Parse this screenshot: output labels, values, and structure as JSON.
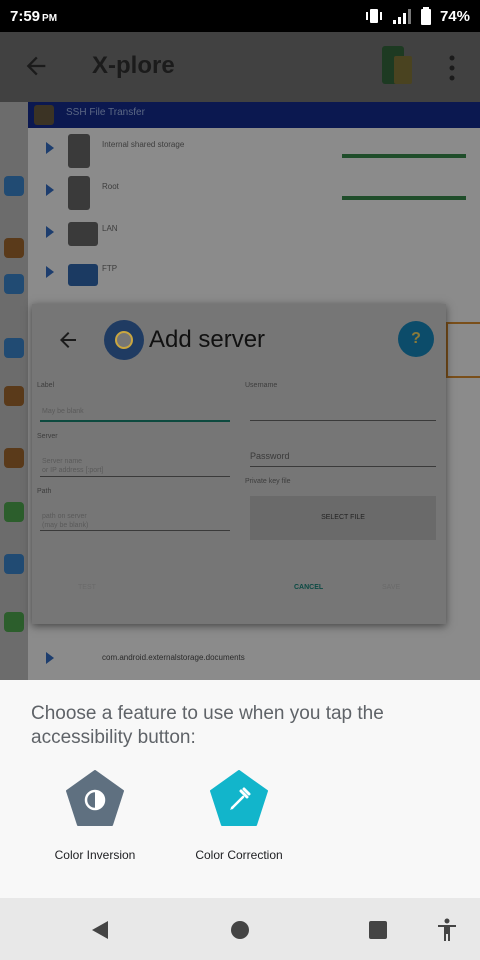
{
  "status": {
    "time": "7:59",
    "ampm": "PM",
    "battery": "74%",
    "icons": [
      "vibrate-icon",
      "signal-icon",
      "battery-icon"
    ]
  },
  "app": {
    "title": "X-plore",
    "ssh_header": "SSH File Transfer",
    "rows": [
      {
        "name": "Internal shared storage"
      },
      {
        "name": "Root"
      },
      {
        "name": "LAN"
      },
      {
        "name": "FTP"
      }
    ],
    "path_row": "com.android.externalstorage.documents"
  },
  "dialog": {
    "title": "Add server",
    "help": "?",
    "label_label": "Label",
    "label_hint": "May be blank",
    "server_label": "Server",
    "server_hint": "Server name\nor IP address [:port]",
    "path_label": "Path",
    "path_hint": "path on server\n(may be blank)",
    "username_label": "Username",
    "password_placeholder": "Password",
    "private_key_label": "Private key file",
    "select_file": "SELECT FILE",
    "test": "TEST",
    "cancel": "CANCEL",
    "save": "SAVE"
  },
  "sheet": {
    "prompt": "Choose a feature to use when you tap the accessibility button:",
    "features": [
      {
        "label": "Color Inversion",
        "icon": "color-inversion-icon",
        "color": "#5f7080"
      },
      {
        "label": "Color Correction",
        "icon": "color-correction-icon",
        "color": "#12b5cb"
      }
    ]
  },
  "colors": {
    "sheet_bg": "#f8f8f8",
    "scrim": "#1e1e1e",
    "accent_teal": "#12b5cb"
  }
}
